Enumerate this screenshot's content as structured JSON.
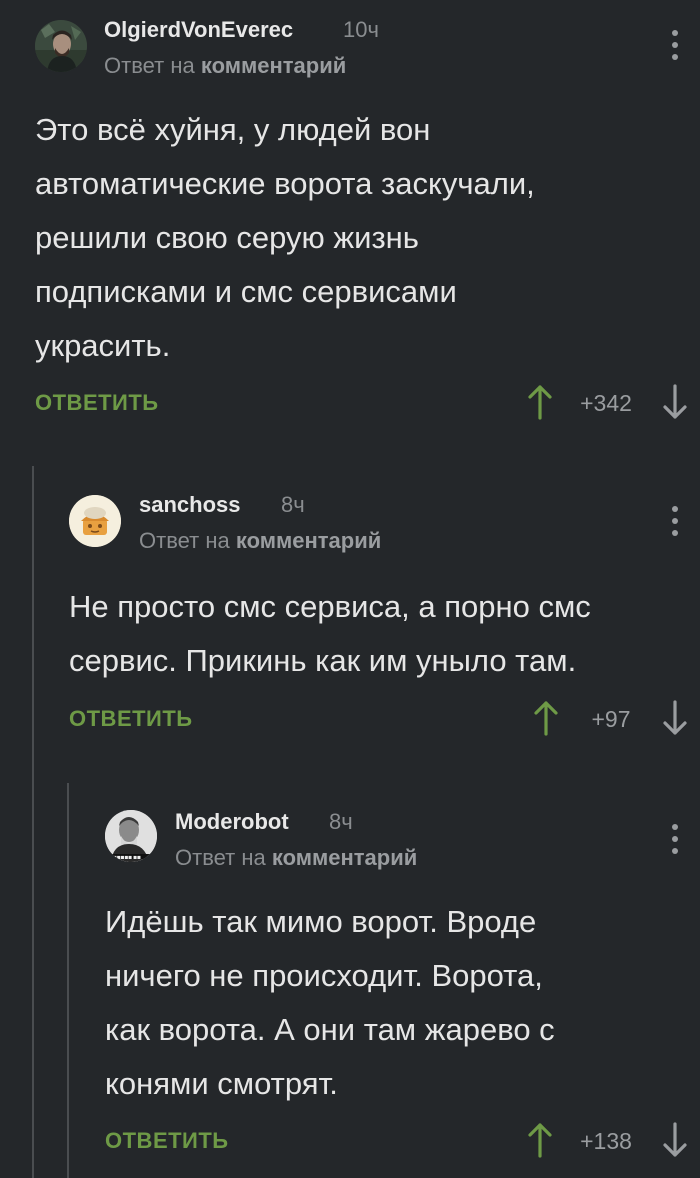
{
  "comments": [
    {
      "username": "OlgierdVonEverec",
      "time": "10ч",
      "reply_prefix": "Ответ на",
      "reply_target": "комментарий",
      "body_lines": [
        "Это всё хуйня, у людей вон",
        "автоматические ворота заскучали,",
        "решили свою серую жизнь",
        "подписками и смс сервисами",
        "украсить."
      ],
      "reply_label": "ОТВЕТИТЬ",
      "rating": "+342"
    },
    {
      "username": "sanchoss",
      "time": "8ч",
      "reply_prefix": "Ответ на",
      "reply_target": "комментарий",
      "body_lines": [
        "Не просто смс сервиса, а порно смс",
        "сервис. Прикинь как им уныло там."
      ],
      "reply_label": "ОТВЕТИТЬ",
      "rating": "+97"
    },
    {
      "username": "Moderobot",
      "time": "8ч",
      "reply_prefix": "Ответ на",
      "reply_target": "комментарий",
      "body_lines": [
        "Идёшь так мимо ворот. Вроде",
        "ничего не происходит. Ворота,",
        "как ворота. А они там жарево с",
        "конями смотрят."
      ],
      "reply_label": "ОТВЕТИТЬ",
      "rating": "+138"
    }
  ],
  "colors": {
    "background": "#24272a",
    "accent_green": "#6e9a46",
    "muted": "#8a8d90"
  },
  "icons": {
    "upvote": "arrow-up-icon",
    "downvote": "arrow-down-icon",
    "menu": "more-vertical-icon"
  }
}
